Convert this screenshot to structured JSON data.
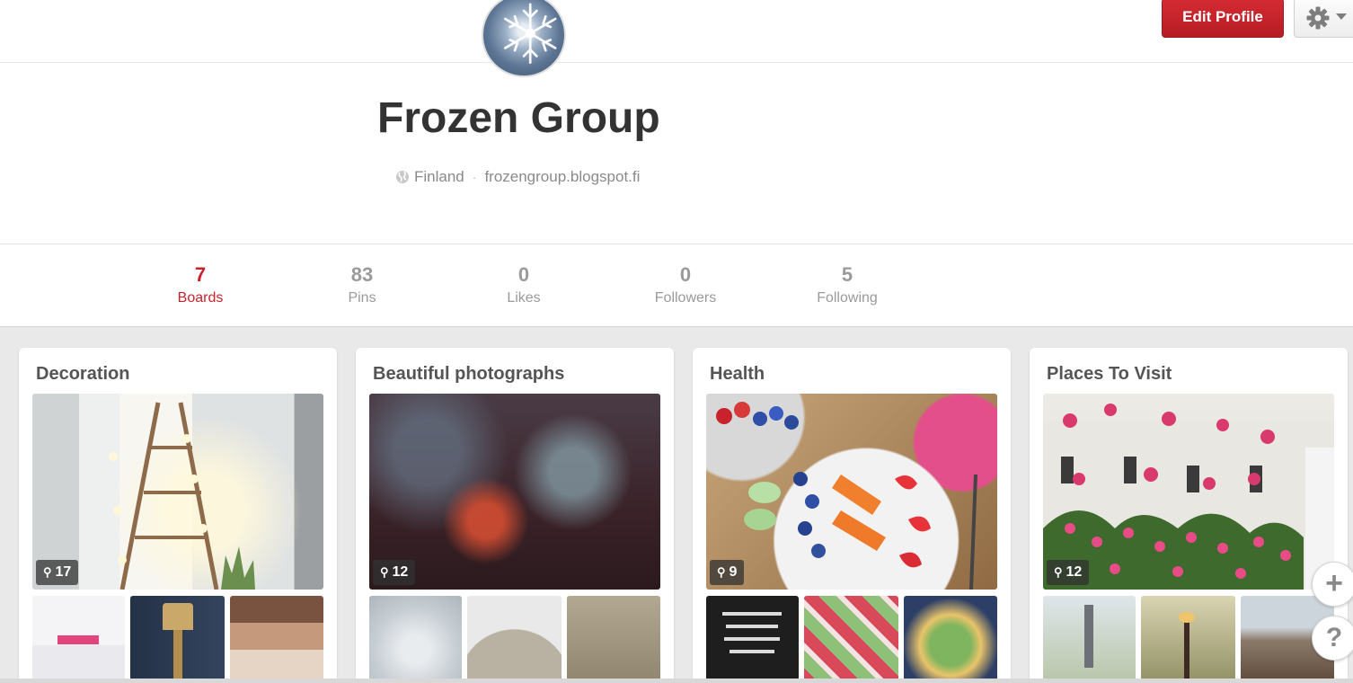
{
  "header": {
    "profile_name": "Frozen Group",
    "location": "Finland",
    "separator": "·",
    "website": "frozengroup.blogspot.fi",
    "edit_profile_label": "Edit Profile"
  },
  "stats": [
    {
      "count": "7",
      "label": "Boards",
      "active": true
    },
    {
      "count": "83",
      "label": "Pins",
      "active": false
    },
    {
      "count": "0",
      "label": "Likes",
      "active": false
    },
    {
      "count": "0",
      "label": "Followers",
      "active": false
    },
    {
      "count": "5",
      "label": "Following",
      "active": false
    }
  ],
  "boards": [
    {
      "title": "Decoration",
      "pin_count": "17"
    },
    {
      "title": "Beautiful photographs",
      "pin_count": "12"
    },
    {
      "title": "Health",
      "pin_count": "9"
    },
    {
      "title": "Places To Visit",
      "pin_count": "12"
    }
  ],
  "float_buttons": {
    "add": "+",
    "help": "?"
  },
  "icons": {
    "avatar": "snowflake-avatar",
    "settings": "gear-icon",
    "dropdown": "caret-down-icon",
    "location": "globe-icon",
    "pin": "pin-icon"
  },
  "colors": {
    "accent": "#c8232c",
    "edit_button": "#c8232c",
    "muted_text": "#9a9a9a",
    "page_background": "#e9e9e9"
  }
}
